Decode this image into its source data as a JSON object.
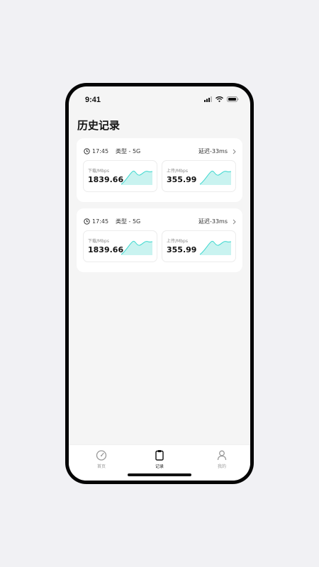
{
  "status_bar": {
    "time": "9:41"
  },
  "page": {
    "title": "历史记录"
  },
  "records": [
    {
      "time": "17:45",
      "type": "类型 - 5G",
      "latency": "延迟-33ms",
      "download": {
        "label": "下载/Mbps",
        "value": "1839.66"
      },
      "upload": {
        "label": "上传/Mbps",
        "value": "355.99"
      }
    },
    {
      "time": "17:45",
      "type": "类型 - 5G",
      "latency": "延迟-33ms",
      "download": {
        "label": "下载/Mbps",
        "value": "1839.66"
      },
      "upload": {
        "label": "上传/Mbps",
        "value": "355.99"
      }
    }
  ],
  "tabbar": {
    "items": [
      {
        "label": "首页",
        "icon": "speedometer-icon"
      },
      {
        "label": "记录",
        "icon": "clipboard-icon"
      },
      {
        "label": "我的",
        "icon": "user-icon"
      }
    ]
  },
  "colors": {
    "accent": "#3ed8cf",
    "accent_fill": "#c9f3f0"
  }
}
